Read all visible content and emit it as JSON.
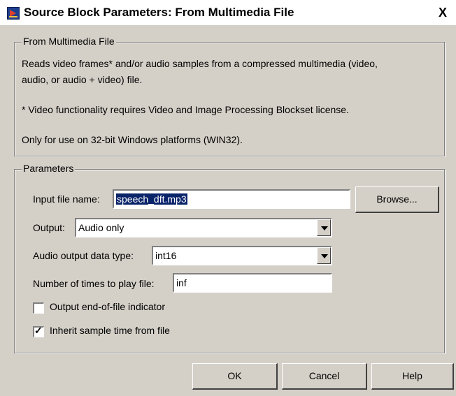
{
  "window": {
    "title": "Source Block Parameters: From Multimedia File",
    "close_label": "X"
  },
  "description_group": {
    "legend": "From Multimedia File",
    "line1": "Reads video frames* and/or audio samples from a compressed multimedia (video,",
    "line2": "audio, or audio + video) file.",
    "note": "* Video functionality requires Video and Image Processing Blockset license.",
    "platform": "Only for use on 32-bit Windows platforms (WIN32)."
  },
  "parameters": {
    "legend": "Parameters",
    "input_file_label": "Input file name:",
    "input_file_value": "speech_dft.mp3",
    "browse_label": "Browse...",
    "output_label": "Output:",
    "output_value": "Audio only",
    "audio_type_label": "Audio output data type:",
    "audio_type_value": "int16",
    "play_times_label": "Number of times to play file:",
    "play_times_value": "inf",
    "eof_label": "Output end-of-file indicator",
    "eof_checked": false,
    "inherit_label": "Inherit sample time from file",
    "inherit_checked": true,
    "check_glyph": "✓"
  },
  "buttons": {
    "ok": "OK",
    "cancel": "Cancel",
    "help": "Help"
  }
}
